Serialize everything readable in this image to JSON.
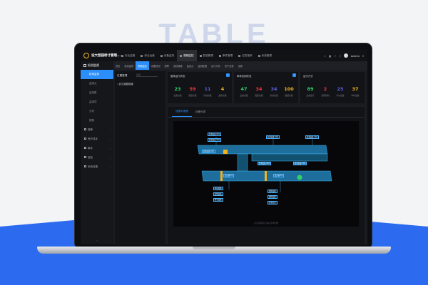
{
  "background": {
    "word": "TABLE",
    "accent": "#2c6bf0"
  },
  "app": {
    "title": "设大型园桥寸管理...",
    "nav": [
      {
        "label": "安全监管"
      },
      {
        "label": "综合运营"
      },
      {
        "label": "设备监测"
      },
      {
        "label": "视频监控",
        "active": true
      },
      {
        "label": "智能管理"
      },
      {
        "label": "事件管理"
      },
      {
        "label": "应急指挥"
      },
      {
        "label": "系统管理"
      }
    ],
    "user": "Admin"
  },
  "sidebar": {
    "header": "检测监视",
    "items": [
      {
        "label": "检测监测",
        "active": true
      },
      {
        "label": "监测点"
      },
      {
        "label": "监测数"
      },
      {
        "label": "监测项"
      },
      {
        "label": "分析"
      },
      {
        "label": "报警"
      }
    ],
    "groups": [
      {
        "label": "报警"
      },
      {
        "label": "养护成本"
      },
      {
        "label": "事件"
      },
      {
        "label": "巡检"
      },
      {
        "label": "系统设置"
      }
    ],
    "footer": "‹"
  },
  "tabs": [
    {
      "label": "首页"
    },
    {
      "label": "检测监视"
    },
    {
      "label": "视频监控",
      "active": true
    },
    {
      "label": "设备检测"
    },
    {
      "label": "报警"
    },
    {
      "label": "巡检管理"
    },
    {
      "label": "监测点"
    },
    {
      "label": "监测数据"
    },
    {
      "label": "运行分析"
    },
    {
      "label": "资产台账"
    },
    {
      "label": "设置"
    }
  ],
  "tree": {
    "title": "位置管理",
    "search_placeholder": "搜索",
    "root": "武汉道路隧道"
  },
  "cards": [
    {
      "title": "整体运行状态",
      "stats": [
        {
          "value": "23",
          "label": "设备总量",
          "color": "#2fd26a"
        },
        {
          "value": "59",
          "label": "报警总量",
          "color": "#ee3340"
        },
        {
          "value": "11",
          "label": "离线总量",
          "color": "#5a5dd9"
        },
        {
          "value": "4",
          "label": "故障总量",
          "color": "#f3b21b"
        }
      ]
    },
    {
      "title": "单体控制状态",
      "stats": [
        {
          "value": "47",
          "label": "设备总量",
          "color": "#2fd26a"
        },
        {
          "value": "34",
          "label": "报警总量",
          "color": "#ee3340"
        },
        {
          "value": "34",
          "label": "离线总量",
          "color": "#5a5dd9"
        },
        {
          "value": "100",
          "label": "数据总量",
          "color": "#f3b21b"
        }
      ]
    },
    {
      "title": "运行方式",
      "stats": [
        {
          "value": "89",
          "label": "设备运行",
          "color": "#2fd26a"
        },
        {
          "value": "2",
          "label": "远程控制",
          "color": "#ee3340"
        },
        {
          "value": "25",
          "label": "手动设备",
          "color": "#5a5dd9"
        },
        {
          "value": "37",
          "label": "本地设备",
          "color": "#f3b21b"
        }
      ]
    }
  ],
  "main": {
    "tabs": [
      {
        "label": "设备平面图",
        "active": true
      },
      {
        "label": "设备列表"
      }
    ],
    "caption": "武汉道路隧道  设备平面布局图"
  },
  "diagram": {
    "labels": [
      "监测设备 001",
      "监测设备 002",
      "监测设备 003",
      "监测设备 004",
      "监测设备 005",
      "监测设备 006",
      "监测设备 007",
      "变压器 01",
      "变压器 02",
      "风机设备",
      "照明设备",
      "排水设备",
      "消防设备",
      "通风设备",
      "安全出口"
    ]
  }
}
